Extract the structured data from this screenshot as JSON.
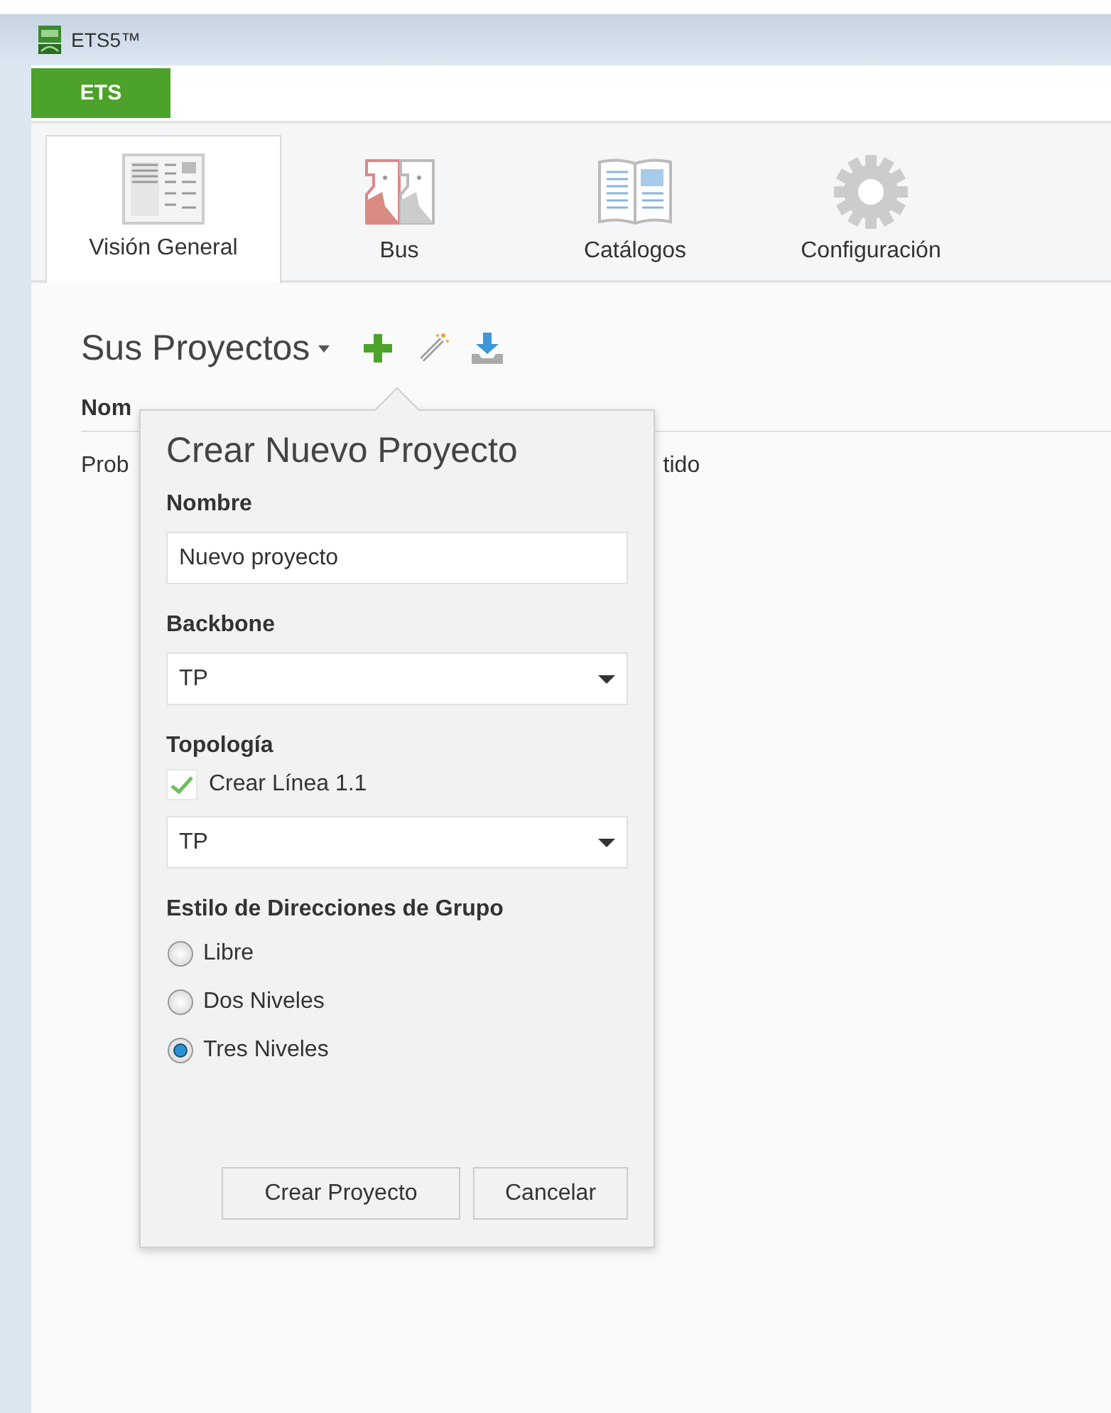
{
  "window": {
    "title": "ETS5™"
  },
  "app_button": {
    "label": "ETS"
  },
  "tabs": [
    {
      "label": "Visión General",
      "selected": true
    },
    {
      "label": "Bus",
      "selected": false
    },
    {
      "label": "Catálogos",
      "selected": false
    },
    {
      "label": "Configuración",
      "selected": false
    }
  ],
  "projects": {
    "title": "Sus Proyectos",
    "table": {
      "columns": [
        "Nom"
      ],
      "rows": [
        [
          "Prob",
          "tido"
        ]
      ]
    }
  },
  "popup": {
    "title": "Crear Nuevo Proyecto",
    "form": [
      {
        "kind": "heading",
        "label": "Nombre"
      },
      {
        "kind": "text",
        "value": "Nuevo proyecto"
      },
      {
        "kind": "heading",
        "label": "Backbone"
      },
      {
        "kind": "select",
        "value": "TP"
      },
      {
        "kind": "heading",
        "label": "Topología"
      },
      {
        "kind": "checkbox",
        "label": "Crear Línea 1.1",
        "checked": true
      },
      {
        "kind": "select",
        "value": "TP"
      },
      {
        "kind": "heading",
        "label": "Estilo de Direcciones de Grupo"
      },
      {
        "kind": "radio",
        "label": "Libre",
        "selected": false
      },
      {
        "kind": "radio",
        "label": "Dos Niveles",
        "selected": false
      },
      {
        "kind": "radio",
        "label": "Tres Niveles",
        "selected": true
      }
    ],
    "buttons": [
      "Crear Proyecto",
      "Cancelar"
    ]
  }
}
